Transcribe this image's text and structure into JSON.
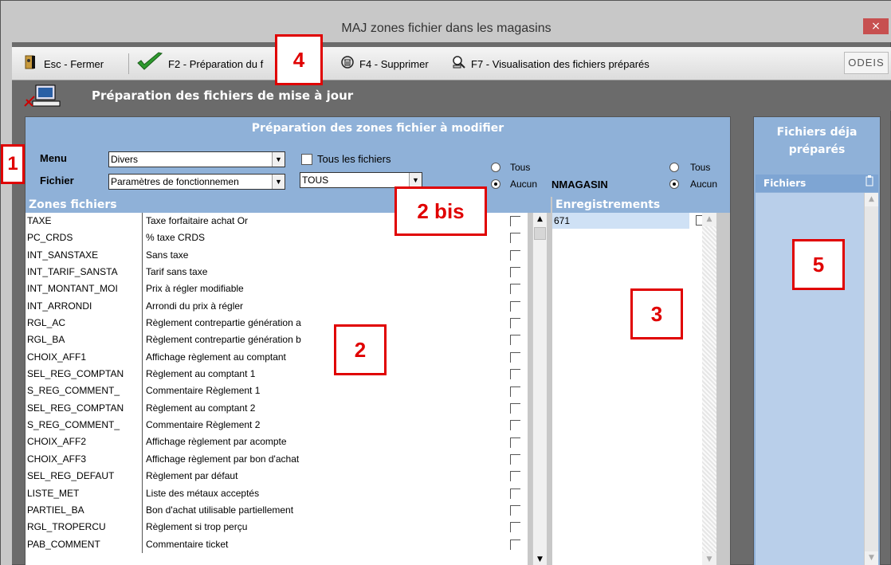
{
  "window": {
    "title": "MAJ zones fichier dans les magasins",
    "close_glyph": "×",
    "accent_close": "#c75050"
  },
  "toolbar": {
    "close_label": "Esc - Fermer",
    "prepare_label": "F2 - Préparation du f",
    "delete_label": "F4 - Supprimer",
    "view_label": "F7 - Visualisation des fichiers préparés",
    "logo_text": "ODEIS"
  },
  "section": {
    "title": "Préparation des fichiers de mise à jour"
  },
  "prep_panel": {
    "title": "Préparation des zones fichier à modifier",
    "menu_label": "Menu",
    "menu_value": "Divers",
    "file_label": "Fichier",
    "file_value": "Paramètres de fonctionnemen",
    "all_files_label": "Tous les fichiers",
    "filter_value": "TOUS",
    "radio_all_label": "Tous",
    "radio_none_label": "Aucun",
    "store_label": "NMAGASIN",
    "radio2_all_label": "Tous",
    "radio2_none_label": "Aucun",
    "header_color": "#8fb1d8"
  },
  "zones": {
    "header": "Zones fichiers",
    "rows": [
      {
        "code": "TAXE",
        "desc": "Taxe forfaitaire achat Or"
      },
      {
        "code": "PC_CRDS",
        "desc": "% taxe CRDS"
      },
      {
        "code": "INT_SANSTAXE",
        "desc": "Sans taxe"
      },
      {
        "code": "INT_TARIF_SANSTA",
        "desc": "Tarif sans taxe"
      },
      {
        "code": "INT_MONTANT_MOI",
        "desc": "Prix à régler modifiable"
      },
      {
        "code": "INT_ARRONDI",
        "desc": "Arrondi du prix à régler"
      },
      {
        "code": "RGL_AC",
        "desc": "Règlement contrepartie génération a"
      },
      {
        "code": "RGL_BA",
        "desc": "Règlement contrepartie génération b"
      },
      {
        "code": "CHOIX_AFF1",
        "desc": "Affichage règlement au comptant"
      },
      {
        "code": "SEL_REG_COMPTAN",
        "desc": "Règlement au comptant 1"
      },
      {
        "code": "S_REG_COMMENT_",
        "desc": "Commentaire Règlement 1"
      },
      {
        "code": "SEL_REG_COMPTAN",
        "desc": "Règlement au comptant 2"
      },
      {
        "code": "S_REG_COMMENT_",
        "desc": "Commentaire Règlement 2"
      },
      {
        "code": "CHOIX_AFF2",
        "desc": "Affichage règlement par acompte"
      },
      {
        "code": "CHOIX_AFF3",
        "desc": "Affichage règlement par bon d'achat"
      },
      {
        "code": "SEL_REG_DEFAUT",
        "desc": "Règlement par défaut"
      },
      {
        "code": "LISTE_MET",
        "desc": "Liste des métaux acceptés"
      },
      {
        "code": "PARTIEL_BA",
        "desc": "Bon d'achat utilisable partiellement"
      },
      {
        "code": "RGL_TROPERCU",
        "desc": "Règlement si trop perçu"
      },
      {
        "code": "PAB_COMMENT",
        "desc": "Commentaire ticket"
      }
    ]
  },
  "records": {
    "header": "Enregistrements",
    "rows": [
      "671"
    ]
  },
  "prepared": {
    "title": "Fichiers déja préparés",
    "column": "Fichiers"
  },
  "markers": {
    "m1": "1",
    "m2": "2",
    "m2bis": "2 bis",
    "m3": "3",
    "m4": "4",
    "m5": "5",
    "color": "#e00000"
  },
  "icons": {
    "arrow_down": "▼",
    "arrow_up": "▲"
  }
}
